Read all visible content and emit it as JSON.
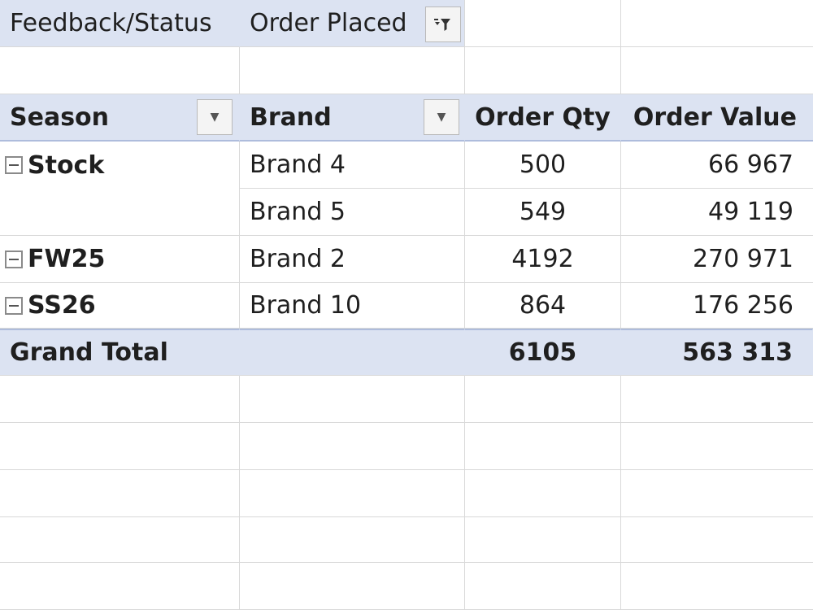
{
  "filter": {
    "field": "Feedback/Status",
    "value": "Order Placed",
    "filter_icon": "funnel-filter-icon"
  },
  "headers": {
    "season": "Season",
    "brand": "Brand",
    "order_qty": "Order Qty",
    "order_value": "Order Value"
  },
  "rows": [
    {
      "season": "Stock",
      "brand": "Brand 4",
      "qty": "500",
      "value": "66 967"
    },
    {
      "season": "",
      "brand": "Brand 5",
      "qty": "549",
      "value": "49 119"
    },
    {
      "season": "FW25",
      "brand": "Brand 2",
      "qty": "4192",
      "value": "270 971"
    },
    {
      "season": "SS26",
      "brand": "Brand 10",
      "qty": "864",
      "value": "176 256"
    }
  ],
  "grand_total": {
    "label": "Grand Total",
    "qty": "6105",
    "value": "563 313"
  },
  "colors": {
    "pivot_header_bg": "#dce3f2",
    "pivot_border": "#aebcdc",
    "gridline": "#d9d9d9"
  }
}
